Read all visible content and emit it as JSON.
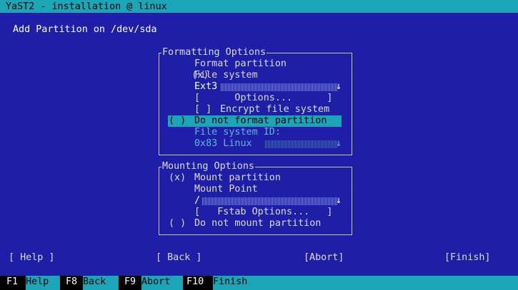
{
  "window": {
    "title": "YaST2 - installation @ linux"
  },
  "page": {
    "title": "Add Partition on /dev/sda"
  },
  "formatting": {
    "frame_title": "Formatting Options",
    "format_radio": "(x)",
    "format_label": "Format partition",
    "fs_label": "File system",
    "fs_value": "Ext3",
    "options_button": "[      Options...      ]",
    "encrypt_checkbox": "[ ]",
    "encrypt_label": "Encrypt file system",
    "noformat_radio": "( )",
    "noformat_label": "Do not format partition",
    "fsid_label": "File system ID:",
    "fsid_value": "0x83 Linux"
  },
  "mounting": {
    "frame_title": "Mounting Options",
    "mount_radio": "(x)",
    "mount_label": "Mount partition",
    "mountpoint_label": "Mount Point",
    "mountpoint_value": "/",
    "fstab_button": "[   Fstab Options...   ]",
    "nomount_radio": "( )",
    "nomount_label": "Do not mount partition"
  },
  "buttons": {
    "help": "[ Help ]",
    "back": "[ Back ]",
    "abort": "[Abort]",
    "finish": "[Finish]"
  },
  "fkeys": [
    {
      "key": "F1",
      "label": "Help"
    },
    {
      "key": "F8",
      "label": "Back"
    },
    {
      "key": "F9",
      "label": "Abort"
    },
    {
      "key": "F10",
      "label": "Finish"
    }
  ],
  "colors": {
    "background": "#1e1ea8",
    "accent": "#1aa6b6",
    "text": "#dcdcdc",
    "disabled": "#5fb8d4"
  }
}
